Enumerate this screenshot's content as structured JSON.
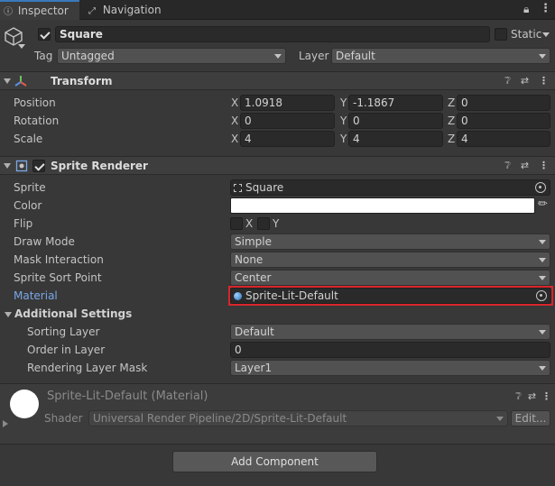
{
  "tabs": [
    {
      "label": "Inspector",
      "icon": "info-icon"
    },
    {
      "label": "Navigation",
      "icon": "navigation-icon"
    }
  ],
  "gameobject": {
    "name": "Square",
    "static_label": "Static",
    "tag_label": "Tag",
    "tag_value": "Untagged",
    "layer_label": "Layer",
    "layer_value": "Default"
  },
  "transform": {
    "title": "Transform",
    "rows": [
      {
        "label": "Position",
        "x": "1.0918",
        "y": "-1.1867",
        "z": "0"
      },
      {
        "label": "Rotation",
        "x": "0",
        "y": "0",
        "z": "0"
      },
      {
        "label": "Scale",
        "x": "4",
        "y": "4",
        "z": "4"
      }
    ]
  },
  "axes": {
    "x": "X",
    "y": "Y",
    "z": "Z"
  },
  "sprite_renderer": {
    "title": "Sprite Renderer",
    "sprite_label": "Sprite",
    "sprite_value": "Square",
    "color_label": "Color",
    "color_value": "#ffffff",
    "flip_label": "Flip",
    "flip_x": "X",
    "flip_y": "Y",
    "draw_mode_label": "Draw Mode",
    "draw_mode_value": "Simple",
    "mask_label": "Mask Interaction",
    "mask_value": "None",
    "sort_point_label": "Sprite Sort Point",
    "sort_point_value": "Center",
    "material_label": "Material",
    "material_value": "Sprite-Lit-Default",
    "additional_label": "Additional Settings",
    "sorting_layer_label": "Sorting Layer",
    "sorting_layer_value": "Default",
    "order_label": "Order in Layer",
    "order_value": "0",
    "rendering_mask_label": "Rendering Layer Mask",
    "rendering_mask_value": "Layer1"
  },
  "material_preview": {
    "title": "Sprite-Lit-Default (Material)",
    "shader_label": "Shader",
    "shader_value": "Universal Render Pipeline/2D/Sprite-Lit-Default",
    "edit_label": "Edit..."
  },
  "add_component_label": "Add Component",
  "colors": {
    "highlight_border": "#d9252b",
    "material_label": "#7aa7e8",
    "tab_accent": "#3a79bb"
  }
}
